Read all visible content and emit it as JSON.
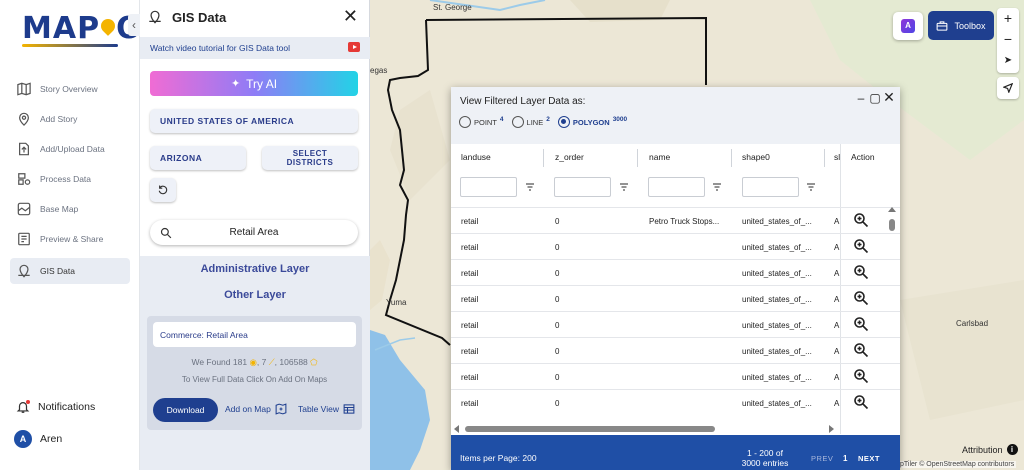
{
  "logo": {
    "text_left": "MAP",
    "text_right": "OG"
  },
  "nav": [
    {
      "label": "Story Overview",
      "icon": "map-icon"
    },
    {
      "label": "Add Story",
      "icon": "location-pin-icon"
    },
    {
      "label": "Add/Upload Data",
      "icon": "upload-icon"
    },
    {
      "label": "Process Data",
      "icon": "process-icon"
    },
    {
      "label": "Base Map",
      "icon": "base-map-icon"
    },
    {
      "label": "Preview & Share",
      "icon": "preview-icon"
    },
    {
      "label": "GIS Data",
      "icon": "gis-data-icon",
      "active": true
    }
  ],
  "notifications": {
    "label": "Notifications"
  },
  "user": {
    "initial": "A",
    "name": "Aren"
  },
  "panel": {
    "title": "GIS Data",
    "tutorial": "Watch video tutorial for GIS Data tool",
    "try_ai": "Try AI",
    "country": "UNITED STATES OF AMERICA",
    "state": "ARIZONA",
    "districts_line1": "SELECT",
    "districts_line2": "DISTRICTS",
    "search_value": "Retail Area",
    "admin_layer": "Administrative Layer",
    "other_layer": "Other Layer",
    "card": {
      "layer_name": "Commerce: Retail Area",
      "found_prefix": "We Found",
      "count_points": "181",
      "count_lines": "7",
      "count_polygons": "106588",
      "hint": "To View Full Data Click On Add On Maps",
      "download": "Download",
      "add_on_map": "Add on Map",
      "table_view": "Table View"
    }
  },
  "map": {
    "labels": {
      "st_george": "St. George",
      "vegas": "egas",
      "yuma": "Yuma",
      "carlsbad": "Carlsbad"
    },
    "toolbox": "Toolbox",
    "ai_badge": "A",
    "attribution": "Attribution",
    "credits": "pTiler © OpenStreetMap contributors",
    "colors": {
      "land": "#ece7d6",
      "water": "#8fc1e8",
      "border": "#111111",
      "accent": "#1f3f8f"
    }
  },
  "modal": {
    "title": "View Filtered Layer Data as:",
    "options": [
      {
        "label": "POINT",
        "count": "4"
      },
      {
        "label": "LINE",
        "count": "2"
      },
      {
        "label": "POLYGON",
        "count": "3000",
        "selected": true
      }
    ],
    "columns": [
      "landuse",
      "z_order",
      "name",
      "shape0",
      "sl"
    ],
    "action_header": "Action",
    "rows": [
      [
        "retail",
        "0",
        "Petro Truck Stops...",
        "united_states_of_...",
        "A"
      ],
      [
        "retail",
        "0",
        "",
        "united_states_of_...",
        "A"
      ],
      [
        "retail",
        "0",
        "",
        "united_states_of_...",
        "A"
      ],
      [
        "retail",
        "0",
        "",
        "united_states_of_...",
        "A"
      ],
      [
        "retail",
        "0",
        "",
        "united_states_of_...",
        "A"
      ],
      [
        "retail",
        "0",
        "",
        "united_states_of_...",
        "A"
      ],
      [
        "retail",
        "0",
        "",
        "united_states_of_...",
        "A"
      ],
      [
        "retail",
        "0",
        "",
        "united_states_of_...",
        "A"
      ]
    ],
    "footer": {
      "per_page": "Items per Page: 200",
      "range_line1": "1 - 200 of",
      "range_line2": "3000 entries",
      "prev": "PREV",
      "page": "1",
      "next": "NEXT"
    }
  }
}
